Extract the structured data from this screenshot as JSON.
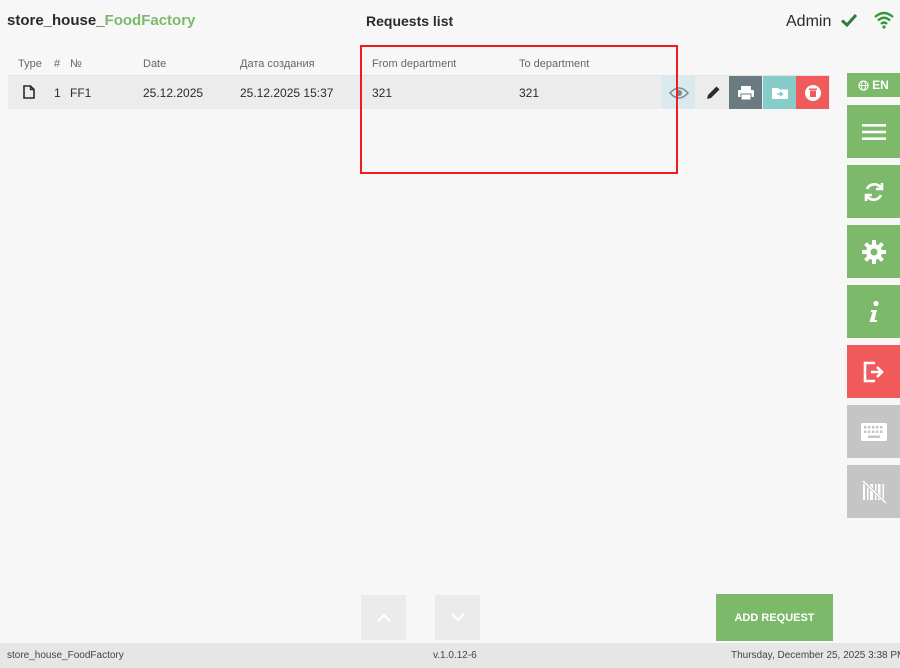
{
  "header": {
    "app_title_prefix": "store_house_",
    "app_title_accent": "FoodFactory",
    "page_title": "Requests list",
    "user_name": "Admin",
    "status_icons": [
      "check-icon",
      "wifi-icon"
    ]
  },
  "table": {
    "columns": {
      "type": "Type",
      "num": "#",
      "no": "№",
      "date": "Date",
      "created": "Дата создания",
      "from": "From department",
      "to": "To department"
    },
    "rows": [
      {
        "icon": "document-icon",
        "num": "1",
        "no": "FF1",
        "date": "25.12.2025",
        "created": "25.12.2025 15:37",
        "from": "321",
        "to": "321",
        "actions": [
          "view-icon",
          "edit-icon",
          "print-icon",
          "folder-move-icon",
          "delete-icon"
        ]
      }
    ]
  },
  "sidebar": {
    "language": "EN",
    "buttons": [
      "menu-icon",
      "sync-icon",
      "settings-icon",
      "info-icon",
      "logout-icon",
      "keyboard-icon",
      "barcode-off-icon"
    ]
  },
  "bottom": {
    "add_request_label": "ADD REQUEST",
    "nav": [
      "chevron-up-icon",
      "chevron-down-icon"
    ]
  },
  "footer": {
    "app_name": "store_house_FoodFactory",
    "version": "v.1.0.12-6",
    "datetime": "Thursday, December 25, 2025 3:38 PM"
  },
  "colors": {
    "accent": "#7cb96a",
    "danger": "#f05a5a",
    "highlight": "#ee1c1c",
    "print_btn": "#697b80",
    "folder_btn": "#86cdc9"
  }
}
